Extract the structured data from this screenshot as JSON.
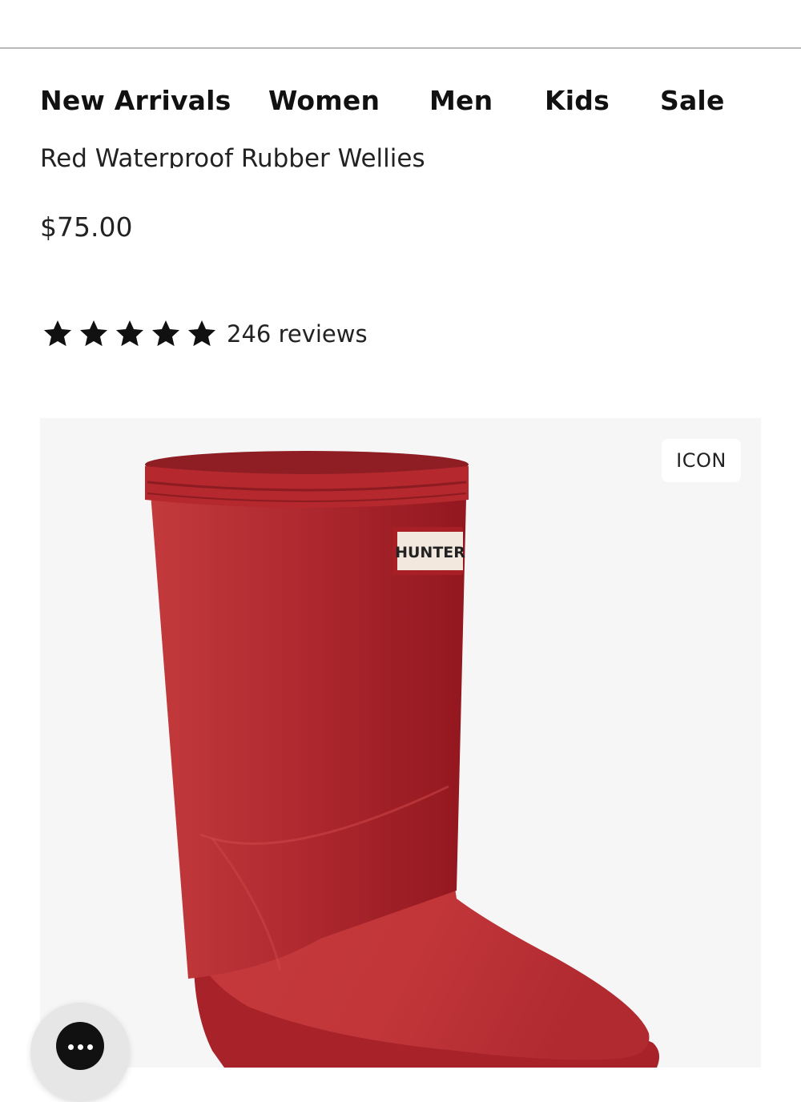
{
  "nav": {
    "items": [
      {
        "label": "New Arrivals"
      },
      {
        "label": "Women"
      },
      {
        "label": "Men"
      },
      {
        "label": "Kids"
      },
      {
        "label": "Sale"
      }
    ]
  },
  "product": {
    "title": "Red Waterproof Rubber Wellies",
    "price": "$75.00",
    "rating": {
      "stars": 5,
      "max_stars": 5,
      "reviews_label": "246 reviews"
    },
    "image": {
      "badge": "ICON",
      "brand_label": "HUNTER",
      "icon": "red-rain-boot-image"
    }
  },
  "chat": {
    "icon": "more-dots-icon"
  },
  "colors": {
    "boot_red": "#b52a30",
    "image_background": "#f6f6f7",
    "text": "#111111"
  }
}
